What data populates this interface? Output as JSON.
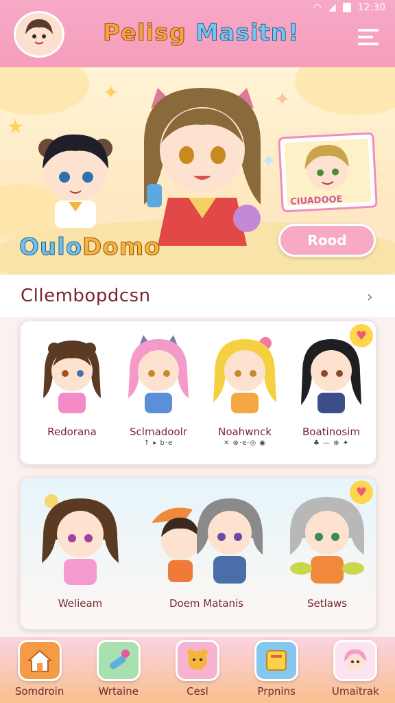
{
  "status": {
    "time": "12:30"
  },
  "header": {
    "title_part1": "Pelisg",
    "title_part2": "Masitn!"
  },
  "hero": {
    "logo_part1": "Oulo",
    "logo_part2": "Domo",
    "card_label": "CIUADOOE",
    "read_button": "Rood"
  },
  "section": {
    "title": "Cllembopdcsn"
  },
  "row1": [
    {
      "name": "Redorana",
      "sub": ""
    },
    {
      "name": "Sclmadoolr",
      "sub": "↑ ▸ b·e"
    },
    {
      "name": "Noahwnck",
      "sub": "✕ ⊗·e·◎ ◉"
    },
    {
      "name": "Boatinosim",
      "sub": "♣ — ⊕ ✦"
    }
  ],
  "row2": [
    {
      "name": "Welieam"
    },
    {
      "name": "Doem Matanis"
    },
    {
      "name": "Setlaws"
    }
  ],
  "nav": [
    {
      "label": "Somdroin",
      "icon": "home-icon",
      "color": "#f59a45"
    },
    {
      "label": "Wrtaine",
      "icon": "brush-icon",
      "color": "#8fd6a0"
    },
    {
      "label": "Cesl",
      "icon": "pet-icon",
      "color": "#f6b3d2"
    },
    {
      "label": "Prpnins",
      "icon": "book-icon",
      "color": "#86c7f0"
    },
    {
      "label": "Umaitrak",
      "icon": "avatar-icon",
      "color": "#f7c3d9"
    }
  ]
}
